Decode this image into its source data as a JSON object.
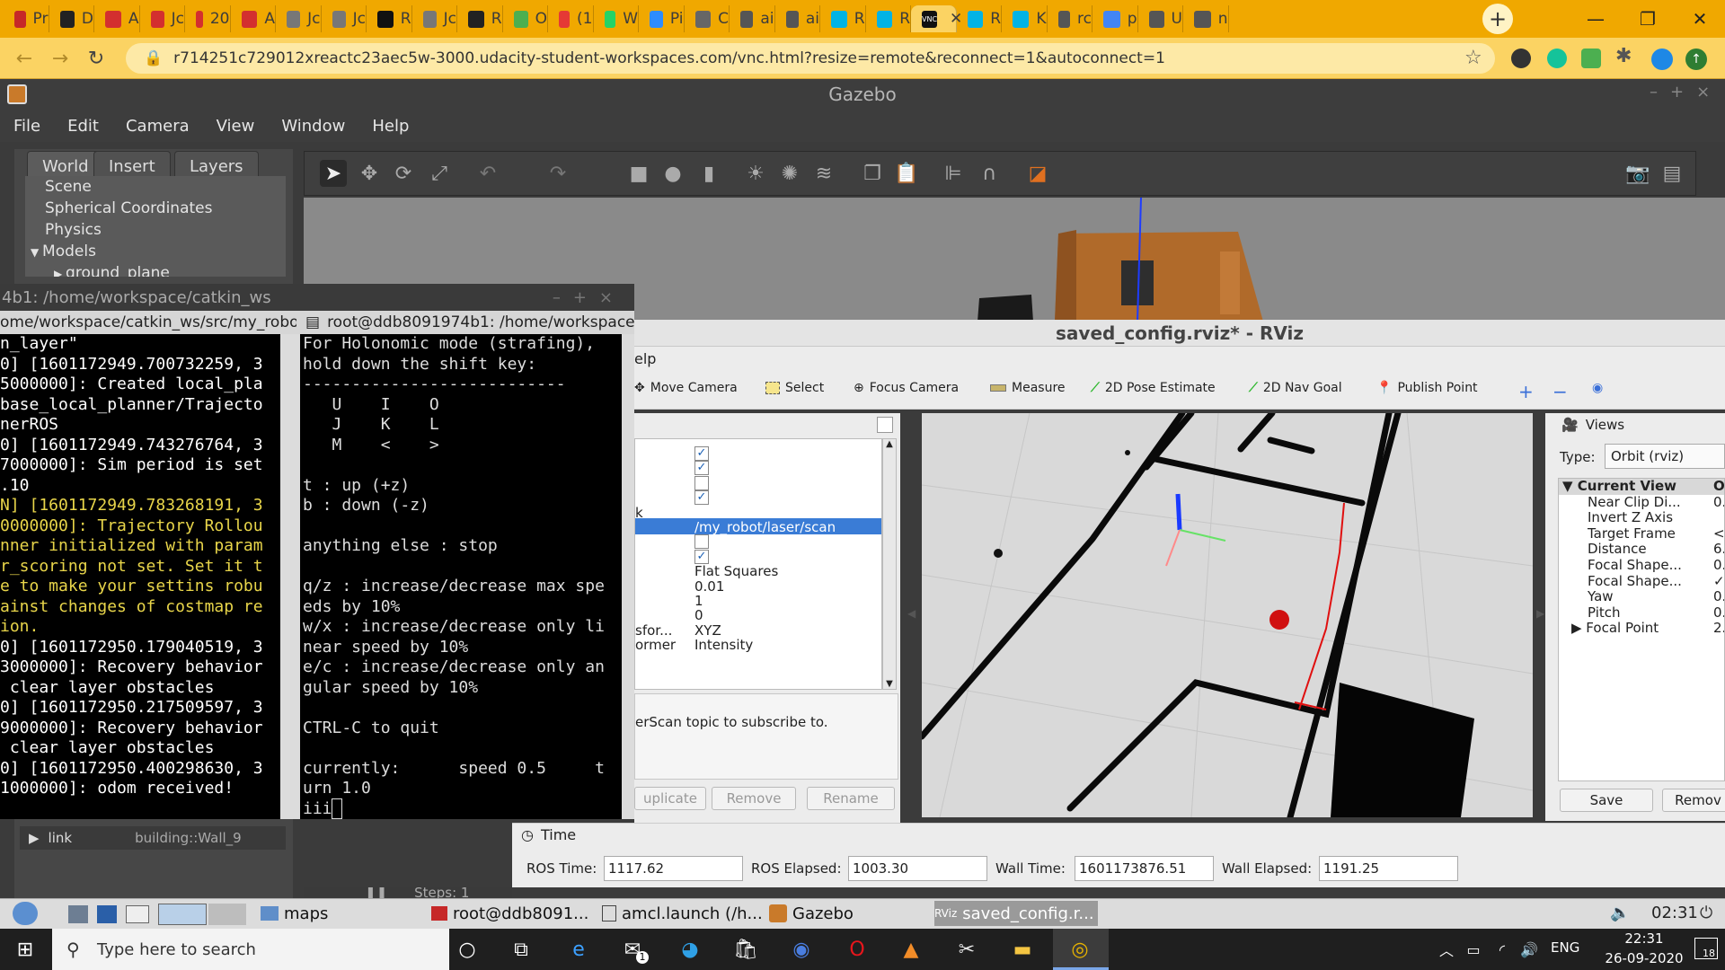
{
  "browser": {
    "tabs": [
      {
        "label": "Pr",
        "color": "#c62828",
        "active": false
      },
      {
        "label": "D",
        "color": "#222222",
        "active": false
      },
      {
        "label": "A",
        "color": "#d32f2f",
        "active": false
      },
      {
        "label": "Jc",
        "color": "#d32f2f",
        "active": false
      },
      {
        "label": "20",
        "color": "#d32f2f",
        "active": false
      },
      {
        "label": "A",
        "color": "#d32f2f",
        "active": false
      },
      {
        "label": "Jc",
        "color": "#777777",
        "active": false
      },
      {
        "label": "Jc",
        "color": "#777777",
        "active": false
      },
      {
        "label": "R",
        "color": "#111111",
        "active": false
      },
      {
        "label": "Jc",
        "color": "#777777",
        "active": false
      },
      {
        "label": "R",
        "color": "#222222",
        "active": false
      },
      {
        "label": "O",
        "color": "#4caf50",
        "active": false
      },
      {
        "label": "(1",
        "color": "#e53935",
        "active": false
      },
      {
        "label": "W",
        "color": "#25d366",
        "active": false
      },
      {
        "label": "Pi",
        "color": "#2d8cff",
        "active": false
      },
      {
        "label": "C",
        "color": "#666666",
        "active": false
      },
      {
        "label": "ai",
        "color": "#555555",
        "active": false
      },
      {
        "label": "ai",
        "color": "#555555",
        "active": false
      },
      {
        "label": "R",
        "color": "#02b3e4",
        "active": false
      },
      {
        "label": "R",
        "color": "#02b3e4",
        "active": false
      },
      {
        "label": "VNC",
        "color": "#111111",
        "active": true
      },
      {
        "label": "R",
        "color": "#02b3e4",
        "active": false
      },
      {
        "label": "K",
        "color": "#02b3e4",
        "active": false
      },
      {
        "label": "rc",
        "color": "#555555",
        "active": false
      },
      {
        "label": "p",
        "color": "#4285f4",
        "active": false
      },
      {
        "label": "U",
        "color": "#555555",
        "active": false
      },
      {
        "label": "n",
        "color": "#555555",
        "active": false
      }
    ],
    "url": "r714251c729012xreactc23aec5w-3000.udacity-student-workspaces.com/vnc.html?resize=remote&reconnect=1&autoconnect=1",
    "new_tab": "+",
    "minimize": "—",
    "maximize": "❐",
    "close": "✕"
  },
  "gazebo": {
    "title": "Gazebo",
    "menu": [
      "File",
      "Edit",
      "Camera",
      "View",
      "Window",
      "Help"
    ],
    "tabs": [
      "World",
      "Insert",
      "Layers"
    ],
    "tree": [
      {
        "label": "Scene",
        "indent": 1
      },
      {
        "label": "Spherical Coordinates",
        "indent": 1
      },
      {
        "label": "Physics",
        "indent": 1
      },
      {
        "label": "Models",
        "indent": 0,
        "arrow": "▼"
      },
      {
        "label": "ground_plane",
        "indent": 2,
        "arrow": "▶"
      }
    ],
    "link_row": {
      "label": "link",
      "value": "building::Wall_9"
    },
    "steps_label": "Steps: 1"
  },
  "terminal": {
    "title": "4b1: /home/workspace/catkin_ws",
    "tab_left": "ome/workspace/catkin_ws/src/my_robo",
    "tab_right": "root@ddb8091974b1: /home/workspace",
    "left_lines": [
      {
        "text": "n_layer\"",
        "warn": false
      },
      {
        "text": "0] [1601172949.700732259, 3",
        "warn": false
      },
      {
        "text": "5000000]: Created local_pla",
        "warn": false
      },
      {
        "text": "base_local_planner/Trajecto",
        "warn": false
      },
      {
        "text": "nerROS",
        "warn": false
      },
      {
        "text": "0] [1601172949.743276764, 3",
        "warn": false
      },
      {
        "text": "7000000]: Sim period is set",
        "warn": false
      },
      {
        "text": ".10",
        "warn": false
      },
      {
        "text": "N] [1601172949.783268191, 3",
        "warn": true
      },
      {
        "text": "0000000]: Trajectory Rollou",
        "warn": true
      },
      {
        "text": "nner initialized with param",
        "warn": true
      },
      {
        "text": "r_scoring not set. Set it t",
        "warn": true
      },
      {
        "text": "e to make your settins robu",
        "warn": true
      },
      {
        "text": "ainst changes of costmap re",
        "warn": true
      },
      {
        "text": "ion.",
        "warn": true
      },
      {
        "text": "0] [1601172950.179040519, 3",
        "warn": false
      },
      {
        "text": "3000000]: Recovery behavior",
        "warn": false
      },
      {
        "text": " clear layer obstacles",
        "warn": false
      },
      {
        "text": "0] [1601172950.217509597, 3",
        "warn": false
      },
      {
        "text": "9000000]: Recovery behavior",
        "warn": false
      },
      {
        "text": " clear layer obstacles",
        "warn": false
      },
      {
        "text": "0] [1601172950.400298630, 3",
        "warn": false
      },
      {
        "text": "1000000]: odom received!",
        "warn": false
      }
    ],
    "right_lines": [
      "For Holonomic mode (strafing),",
      "hold down the shift key:",
      "---------------------------",
      "   U    I    O",
      "   J    K    L",
      "   M    <    >",
      "",
      "t : up (+z)",
      "b : down (-z)",
      "",
      "anything else : stop",
      "",
      "q/z : increase/decrease max spe",
      "eds by 10%",
      "w/x : increase/decrease only li",
      "near speed by 10%",
      "e/c : increase/decrease only an",
      "gular speed by 10%",
      "",
      "CTRL-C to quit",
      "",
      "currently:      speed 0.5     t",
      "urn 1.0",
      "iii"
    ]
  },
  "rviz": {
    "title": "saved_config.rviz* - RViz",
    "menu_partial": "elp",
    "tools": [
      "Move Camera",
      "Select",
      "Focus Camera",
      "Measure",
      "2D Pose Estimate",
      "2D Nav Goal",
      "Publish Point"
    ],
    "displays": {
      "rows": [
        {
          "label": "",
          "value": "",
          "check": "checked"
        },
        {
          "label": "",
          "value": "",
          "check": "checked"
        },
        {
          "label": "",
          "value": "",
          "check": "empty"
        },
        {
          "label": "",
          "value": "",
          "check": "checked"
        },
        {
          "label": "k",
          "value": "",
          "check": "none"
        },
        {
          "label": "",
          "value": "/my_robot/laser/scan",
          "check": "none",
          "selected": true
        },
        {
          "label": "",
          "value": "",
          "check": "empty"
        },
        {
          "label": "",
          "value": "",
          "check": "checked"
        },
        {
          "label": "",
          "value": "Flat Squares",
          "check": "none"
        },
        {
          "label": "",
          "value": "0.01",
          "check": "none"
        },
        {
          "label": "",
          "value": "1",
          "check": "none"
        },
        {
          "label": "",
          "value": "0",
          "check": "none"
        },
        {
          "label": "sfor...",
          "value": "XYZ",
          "check": "none"
        },
        {
          "label": "ormer",
          "value": "Intensity",
          "check": "none"
        }
      ],
      "description": "erScan topic to subscribe to.",
      "buttons": [
        "uplicate",
        "Remove",
        "Rename"
      ]
    },
    "views": {
      "header": "Views",
      "type_label": "Type:",
      "type_value": "Orbit (rviz)",
      "current_view": "Current View",
      "props": [
        "Near Clip Di...",
        "Invert Z Axis",
        "Target Frame",
        "Distance",
        "Focal Shape...",
        "Focal Shape...",
        "Yaw",
        "Pitch",
        "Focal Point"
      ],
      "values": [
        "0.",
        "",
        "<",
        "6.",
        "0.",
        "✓",
        "0.",
        "0.",
        "2."
      ],
      "column_header": "O",
      "buttons": [
        "Save",
        "Remov"
      ]
    },
    "time": {
      "header": "Time",
      "ros_time_label": "ROS Time:",
      "ros_time": "1117.62",
      "ros_elapsed_label": "ROS Elapsed:",
      "ros_elapsed": "1003.30",
      "wall_time_label": "Wall Time:",
      "wall_time": "1601173876.51",
      "wall_elapsed_label": "Wall Elapsed:",
      "wall_elapsed": "1191.25"
    }
  },
  "lxde_taskbar": {
    "items": [
      "maps",
      "root@ddb8091...",
      "amcl.launch (/h...",
      "Gazebo",
      "saved_config.r..."
    ],
    "clock": "02:31"
  },
  "windows_taskbar": {
    "search_placeholder": "Type here to search",
    "language": "ENG",
    "time": "22:31",
    "date": "26-09-2020",
    "notifications": "18",
    "mail_badge": "1"
  }
}
